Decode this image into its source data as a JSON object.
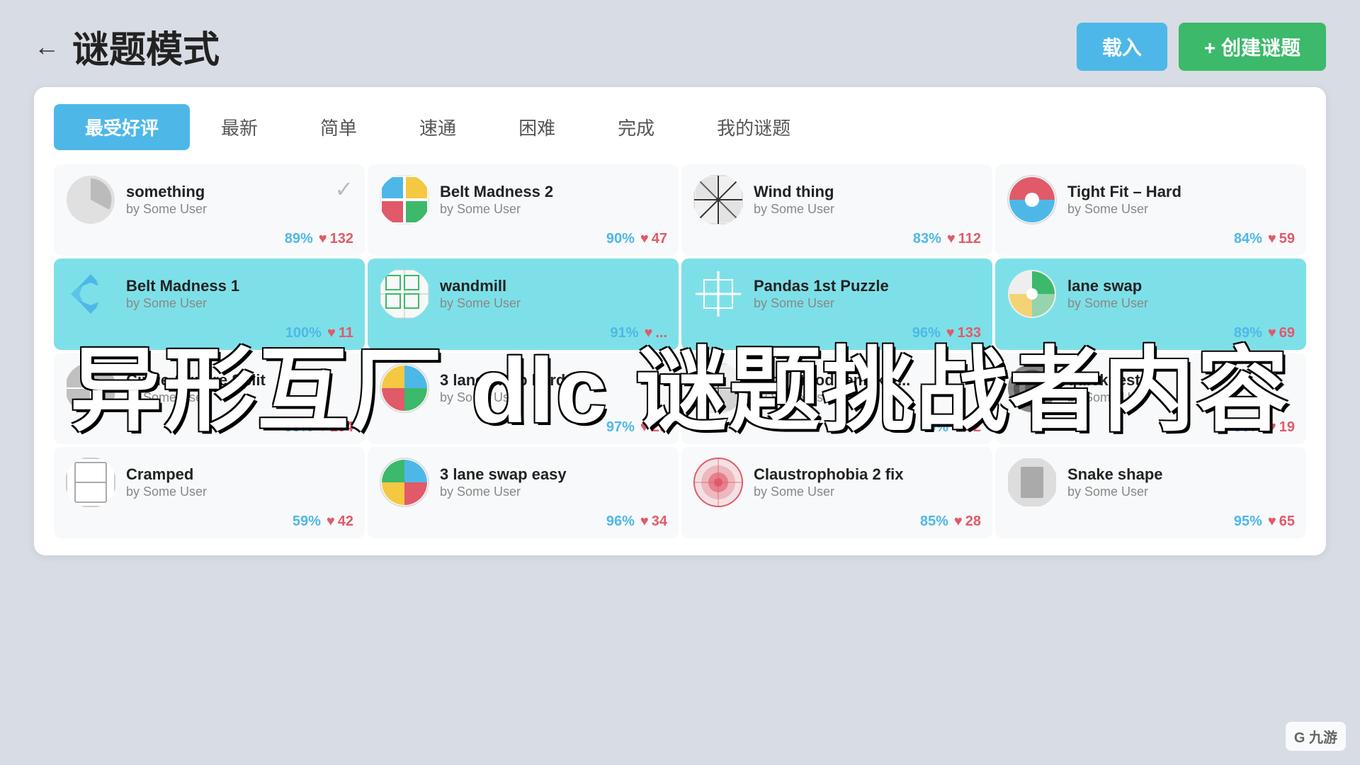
{
  "header": {
    "back_label": "←",
    "title": "谜题模式",
    "load_label": "载入",
    "create_label": "+ 创建谜题"
  },
  "tabs": [
    {
      "label": "最受好评",
      "active": true
    },
    {
      "label": "最新"
    },
    {
      "label": "简单"
    },
    {
      "label": "速通"
    },
    {
      "label": "困难"
    },
    {
      "label": "完成"
    },
    {
      "label": "我的谜题"
    }
  ],
  "overlay_text": "异形互厂 dlc 谜题挑战者内容",
  "watermark": "G 九游",
  "puzzles": [
    {
      "id": "something",
      "title": "something",
      "author": "by Some User",
      "rating": "89%",
      "likes": "132",
      "has_check": true,
      "icon_type": "gray_quarter",
      "highlighted": false
    },
    {
      "id": "belt-madness-2",
      "title": "Belt Madness 2",
      "author": "by Some User",
      "rating": "90%",
      "likes": "47",
      "icon_type": "colorful_quad",
      "highlighted": false
    },
    {
      "id": "wind-thing",
      "title": "Wind thing",
      "author": "by Some User",
      "rating": "83%",
      "likes": "112",
      "icon_type": "pinwheel",
      "highlighted": false
    },
    {
      "id": "tight-fit-hard",
      "title": "Tight Fit – Hard",
      "author": "by Some User",
      "rating": "84%",
      "likes": "59",
      "icon_type": "teal_circle",
      "highlighted": false
    },
    {
      "id": "belt-madness-1",
      "title": "Belt Madness 1",
      "author": "by Some User",
      "rating": "100%",
      "likes": "11",
      "icon_type": "blue_puzzle",
      "highlighted": true
    },
    {
      "id": "wandmill",
      "title": "wandmill",
      "author": "by Some User",
      "rating": "91%",
      "likes": "...",
      "icon_type": "green_grid",
      "highlighted": true
    },
    {
      "id": "pandas-1st-puzzle",
      "title": "Pandas 1st Puzzle",
      "author": "by Some User",
      "rating": "96%",
      "likes": "133",
      "icon_type": "teal_cross",
      "highlighted": true
    },
    {
      "id": "lane-swap",
      "title": "lane swap",
      "author": "by Some User",
      "rating": "89%",
      "likes": "69",
      "icon_type": "green_circle",
      "highlighted": true
    },
    {
      "id": "circle-square-split",
      "title": "Circle-Square Split",
      "author": "by Some User",
      "rating": "93%",
      "likes": "104",
      "icon_type": "gray_square",
      "highlighted": false
    },
    {
      "id": "3-lane-swap-hard",
      "title": "3 lane swap hard",
      "author": "by Some User",
      "rating": "97%",
      "likes": "29",
      "icon_type": "colorful_quad2",
      "highlighted": false
    },
    {
      "id": "puzzlemod-remake",
      "title": "puzzlemod remake ...",
      "author": "by Some User",
      "rating": "96%",
      "likes": "62",
      "icon_type": "pinwheel2",
      "highlighted": false
    },
    {
      "id": "quick-test",
      "title": "quick test",
      "author": "by Some User",
      "rating": "90%",
      "likes": "19",
      "icon_type": "target",
      "highlighted": false
    },
    {
      "id": "cramped",
      "title": "Cramped",
      "author": "by Some User",
      "rating": "59%",
      "likes": "42",
      "icon_type": "white_rect",
      "highlighted": false
    },
    {
      "id": "3-lane-swap-easy",
      "title": "3 lane swap easy",
      "author": "by Some User",
      "rating": "96%",
      "likes": "34",
      "icon_type": "colorful_quad3",
      "highlighted": false
    },
    {
      "id": "claustrophobia-2-fix",
      "title": "Claustrophobia 2 fix",
      "author": "by Some User",
      "rating": "85%",
      "likes": "28",
      "icon_type": "red_target",
      "highlighted": false
    },
    {
      "id": "snake-shape",
      "title": "Snake shape",
      "author": "by Some User",
      "rating": "95%",
      "likes": "65",
      "icon_type": "gray_rect",
      "highlighted": false
    }
  ]
}
